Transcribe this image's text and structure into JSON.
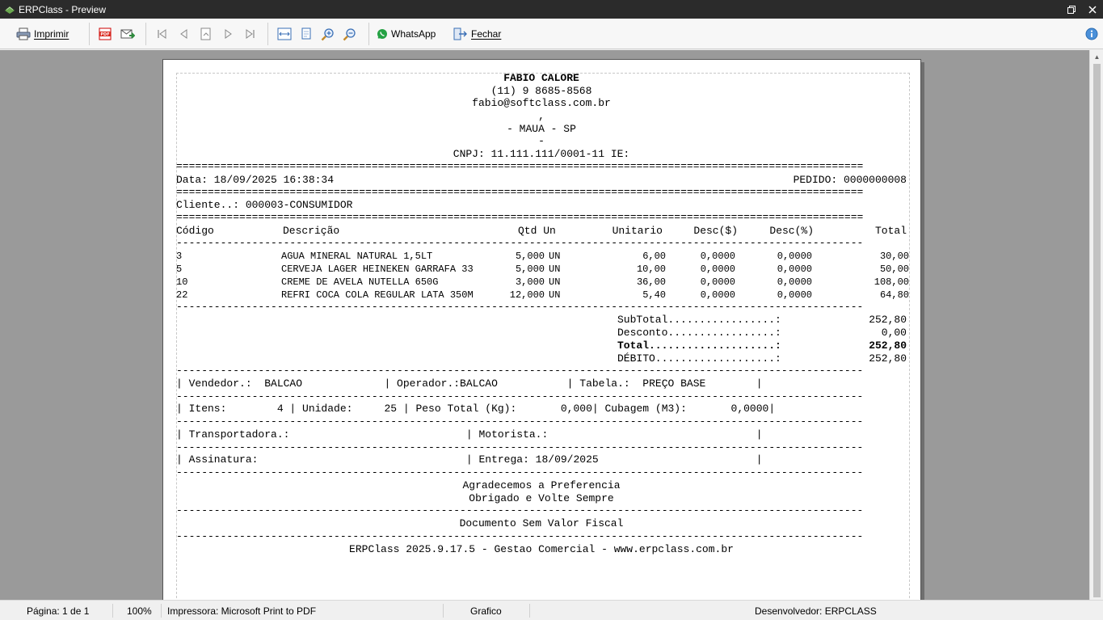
{
  "window": {
    "title": "ERPClass - Preview"
  },
  "toolbar": {
    "print_label": "Imprimir",
    "whatsapp_label": "WhatsApp",
    "close_label": "Fechar"
  },
  "receipt": {
    "company": "FABIO CALORE",
    "phone": "(11) 9 8685-8568",
    "email": "fabio@softclass.com.br",
    "address": ",",
    "city": "- MAUA - SP",
    "extra": "-",
    "cnpj": "CNPJ: 11.111.111/0001-11 IE:",
    "date_label": "Data: 18/09/2025 16:38:34",
    "order_label": "PEDIDO: 0000000008",
    "client_label": "Cliente..: 000003-CONSUMIDOR",
    "columns": [
      "Código",
      "Descrição",
      "Qtd Un",
      "Unitario",
      "Desc($)",
      "Desc(%)",
      "Total"
    ],
    "items": [
      {
        "code": "3",
        "desc": "AGUA MINERAL NATURAL 1,5LT",
        "qty": "5,000",
        "un": "UN",
        "unit": "6,00",
        "desc_val": "0,0000",
        "desc_pct": "0,0000",
        "total": "30,00"
      },
      {
        "code": "5",
        "desc": "CERVEJA LAGER HEINEKEN GARRAFA 33",
        "qty": "5,000",
        "un": "UN",
        "unit": "10,00",
        "desc_val": "0,0000",
        "desc_pct": "0,0000",
        "total": "50,00"
      },
      {
        "code": "10",
        "desc": "CREME DE AVELA NUTELLA 650G",
        "qty": "3,000",
        "un": "UN",
        "unit": "36,00",
        "desc_val": "0,0000",
        "desc_pct": "0,0000",
        "total": "108,00"
      },
      {
        "code": "22",
        "desc": "REFRI COCA COLA REGULAR LATA 350M",
        "qty": "12,000",
        "un": "UN",
        "unit": "5,40",
        "desc_val": "0,0000",
        "desc_pct": "0,0000",
        "total": "64,80"
      }
    ],
    "totals": [
      {
        "label": "SubTotal.................:",
        "value": "252,80",
        "bold": false
      },
      {
        "label": "Desconto.................:",
        "value": "0,00",
        "bold": false
      },
      {
        "label": "Total....................:",
        "value": "252,80",
        "bold": true
      },
      {
        "label": "DÉBITO...................:",
        "value": "252,80",
        "bold": false
      }
    ],
    "seller_line": "| Vendedor.:  BALCAO             | Operador.:BALCAO           | Tabela.:  PREÇO BASE        |",
    "items_line": "| Itens:        4 | Unidade:     25 | Peso Total (Kg):       0,000| Cubagem (M3):       0,0000|",
    "carrier_line": "| Transportadora.:                            | Motorista.:                                 |",
    "signature_line": "| Assinatura:                                 | Entrega: 18/09/2025                         |",
    "thanks_1": "Agradecemos a Preferencia",
    "thanks_2": "Obrigado e Volte Sempre",
    "fiscal_note": "Documento Sem Valor Fiscal",
    "footer": "ERPClass 2025.9.17.5 - Gestao Comercial - www.erpclass.com.br"
  },
  "status": {
    "page": "Página: 1 de 1",
    "zoom": "100%",
    "printer": "Impressora: Microsoft Print to PDF",
    "mode": "Grafico",
    "developer": "Desenvolvedor: ERPCLASS"
  }
}
